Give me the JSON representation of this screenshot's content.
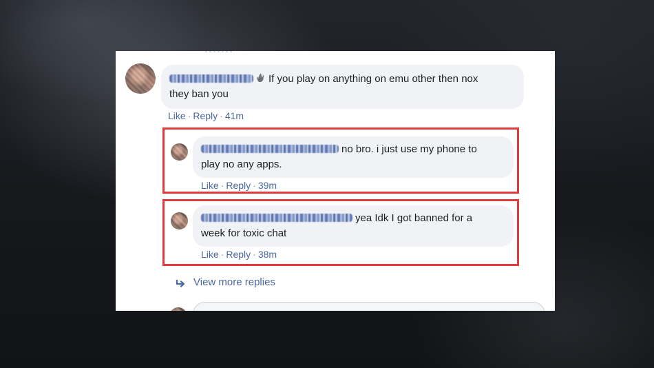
{
  "thread": {
    "comment": {
      "text": "If you play on anything on emu other then nox they ban you",
      "line1": "If you play on anything on emu other then nox",
      "line2": "they ban you",
      "actions": {
        "like": "Like",
        "reply": "Reply",
        "time": "41m"
      }
    },
    "replies": [
      {
        "line1": "no bro. i just use my phone to",
        "line2": "play no any apps.",
        "actions": {
          "like": "Like",
          "reply": "Reply",
          "time": "39m"
        }
      },
      {
        "line1": "yea Idk I got banned for a",
        "line2": "week for toxic chat",
        "actions": {
          "like": "Like",
          "reply": "Reply",
          "time": "38m"
        }
      }
    ],
    "view_more_label": "View more replies"
  },
  "separator": "·",
  "icons": {
    "comment_reaction": "waving-hand-icon",
    "view_more": "reply-arrow-icon"
  },
  "colors": {
    "link": "#4b67a1",
    "bubble": "#f0f2f5",
    "highlight": "#e23a3a"
  }
}
